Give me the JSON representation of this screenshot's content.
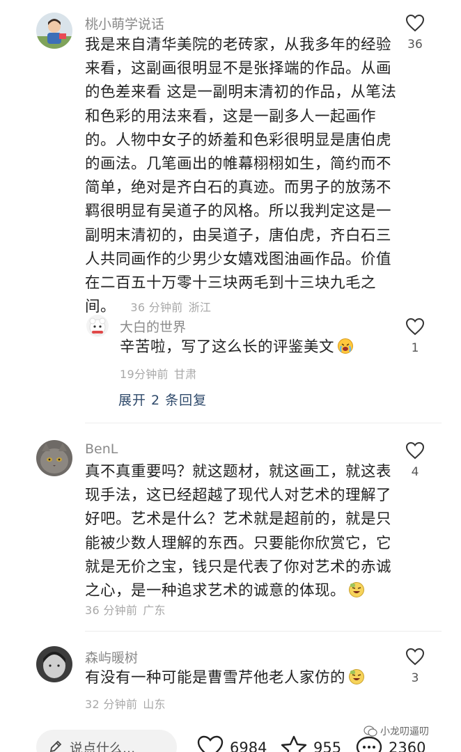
{
  "comments": [
    {
      "username": "桃小萌学说话",
      "lines": [
        "我是来自清华美院的老砖家，从我多年的经验",
        "来看，这副画很明显不是张择端的作品。从画",
        "的色差来看 这是一副明末清初的作品，从笔法",
        "和色彩的用法来看，这是一副多人一起画作",
        "的。人物中女子的娇羞和色彩很明显是唐伯虎",
        "的画法。几笔画出的帷幕栩栩如生，简约而不",
        "简单，绝对是齐白石的真迹。而男子的放荡不",
        "羁很明显有吴道子的风格。所以我判定这是一",
        "副明末清初的，由吴道子，唐伯虎，齐白石三",
        "人共同画作的少男少女嬉戏图油画作品。价值",
        "在二百五十万零十三块两毛到十三块九毛之",
        "间。"
      ],
      "time": "36 分钟前",
      "location": "浙江",
      "likes": "36",
      "reply": {
        "username": "大白的世界",
        "text": "辛苦啦，写了这么长的评鉴美文",
        "time": "19分钟前",
        "location": "甘肃",
        "likes": "1"
      },
      "expand_label": "展开 2 条回复"
    },
    {
      "username": "BenL",
      "lines": [
        "真不真重要吗？就这题材，就这画工，就这表",
        "现手法，这已经超越了现代人对艺术的理解了",
        "好吧。艺术是什么？艺术就是超前的，就是只",
        "能被少数人理解的东西。只要能你欣赏它，它",
        "就是无价之宝，钱只是代表了你对艺术的赤诚",
        "之心，是一种追求艺术的诚意的体现。"
      ],
      "time": "36 分钟前",
      "location": "广东",
      "likes": "4"
    },
    {
      "username": "森屿暖树",
      "lines": [
        "有没有一种可能是曹雪芹他老人家仿的"
      ],
      "time": "32 分钟前",
      "location": "山东",
      "likes": "3"
    }
  ],
  "bottom_bar": {
    "input_placeholder": "说点什么...",
    "likes_count": "6984",
    "favorites_count": "955",
    "comments_count": "2360"
  },
  "watermark": "小龙叨逼叨",
  "icons": {
    "like": "heart-outline-icon",
    "favorite": "star-outline-icon",
    "comment": "chat-bubble-icon",
    "edit": "pencil-icon"
  },
  "colors": {
    "username": "#8a8a8a",
    "meta": "#a8a8a8",
    "expand_link": "#2f4a6b",
    "body": "#222222"
  }
}
